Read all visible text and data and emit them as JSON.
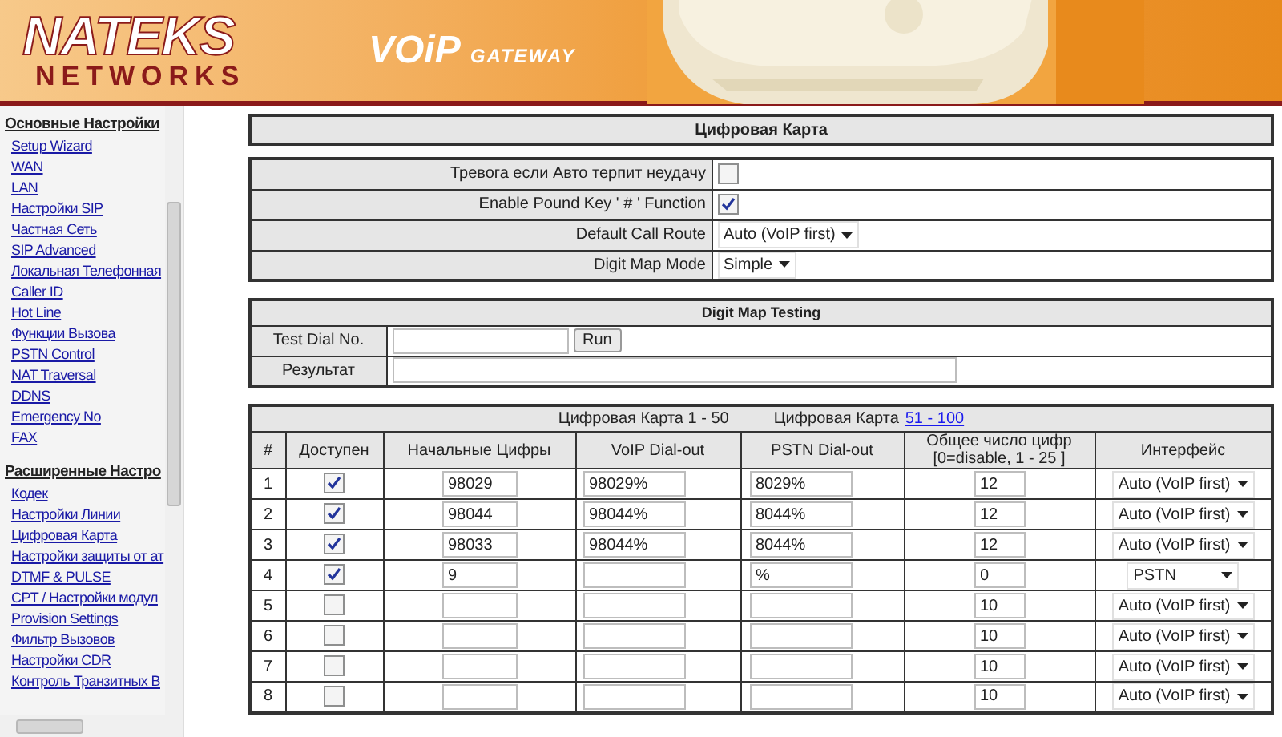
{
  "header": {
    "logo_top": "NATEKS",
    "logo_bottom": "NETWORKS",
    "product": "VOiP",
    "product_sub": "GATEWAY"
  },
  "sidebar": [
    {
      "title": "Основные Настройки",
      "items": [
        "Setup Wizard",
        "WAN",
        "LAN",
        "Настройки SIP",
        "Частная Сеть",
        "SIP Advanced",
        "Локальная Телефонная",
        "Caller ID",
        "Hot Line",
        "Функции Вызова",
        "PSTN Control",
        "NAT Traversal",
        "DDNS",
        "Emergency No",
        "FAX"
      ]
    },
    {
      "title": "Расширенные Настро",
      "items": [
        "Кодек",
        "Настройки Линии",
        "Цифровая Карта",
        "Настройки защиты от ат",
        "DTMF & PULSE",
        "CPT / Настройки модул",
        "Provision Settings",
        "Фильтр Вызовов",
        "Настройки CDR",
        "Контроль Транзитных В"
      ]
    }
  ],
  "page_title": "Цифровая Карта",
  "settings": [
    {
      "label": "Тревога если Авто терпит неудачу",
      "kind": "checkbox",
      "checked": false
    },
    {
      "label": "Enable Pound Key ' # ' Function",
      "kind": "checkbox",
      "checked": true
    },
    {
      "label": "Default Call Route",
      "kind": "select",
      "value": "Auto (VoIP first)"
    },
    {
      "label": "Digit Map Mode",
      "kind": "select",
      "value": "Simple"
    }
  ],
  "testing": {
    "title": "Digit Map Testing",
    "dial_label": "Test Dial No.",
    "run_button": "Run",
    "result_label": "Результат"
  },
  "digit_map": {
    "range_label": "Цифровая Карта 1 - 50",
    "next_label": "Цифровая Карта",
    "next_link": "51 - 100",
    "columns": [
      "#",
      "Доступен",
      "Начальные Цифры",
      "VoIP Dial-out",
      "PSTN Dial-out",
      "Общее число цифр\n[0=disable, 1 - 25 ]",
      "Интерфейс"
    ],
    "rows": [
      {
        "num": "1",
        "enabled": true,
        "prefix": "98029",
        "voip": "98029%",
        "pstn": "8029%",
        "total": "12",
        "interface": "Auto (VoIP first)"
      },
      {
        "num": "2",
        "enabled": true,
        "prefix": "98044",
        "voip": "98044%",
        "pstn": "8044%",
        "total": "12",
        "interface": "Auto (VoIP first)"
      },
      {
        "num": "3",
        "enabled": true,
        "prefix": "98033",
        "voip": "98044%",
        "pstn": "8044%",
        "total": "12",
        "interface": "Auto (VoIP first)"
      },
      {
        "num": "4",
        "enabled": true,
        "prefix": "9",
        "pstn": "%",
        "total": "0",
        "interface": "PSTN"
      },
      {
        "num": "5",
        "enabled": false,
        "total": "10",
        "interface": "Auto (VoIP first)"
      },
      {
        "num": "6",
        "enabled": false,
        "total": "10",
        "interface": "Auto (VoIP first)"
      },
      {
        "num": "7",
        "enabled": false,
        "total": "10",
        "interface": "Auto (VoIP first)"
      },
      {
        "num": "8",
        "enabled": false,
        "total": "10",
        "interface": "Auto (VoIP first)"
      }
    ]
  }
}
